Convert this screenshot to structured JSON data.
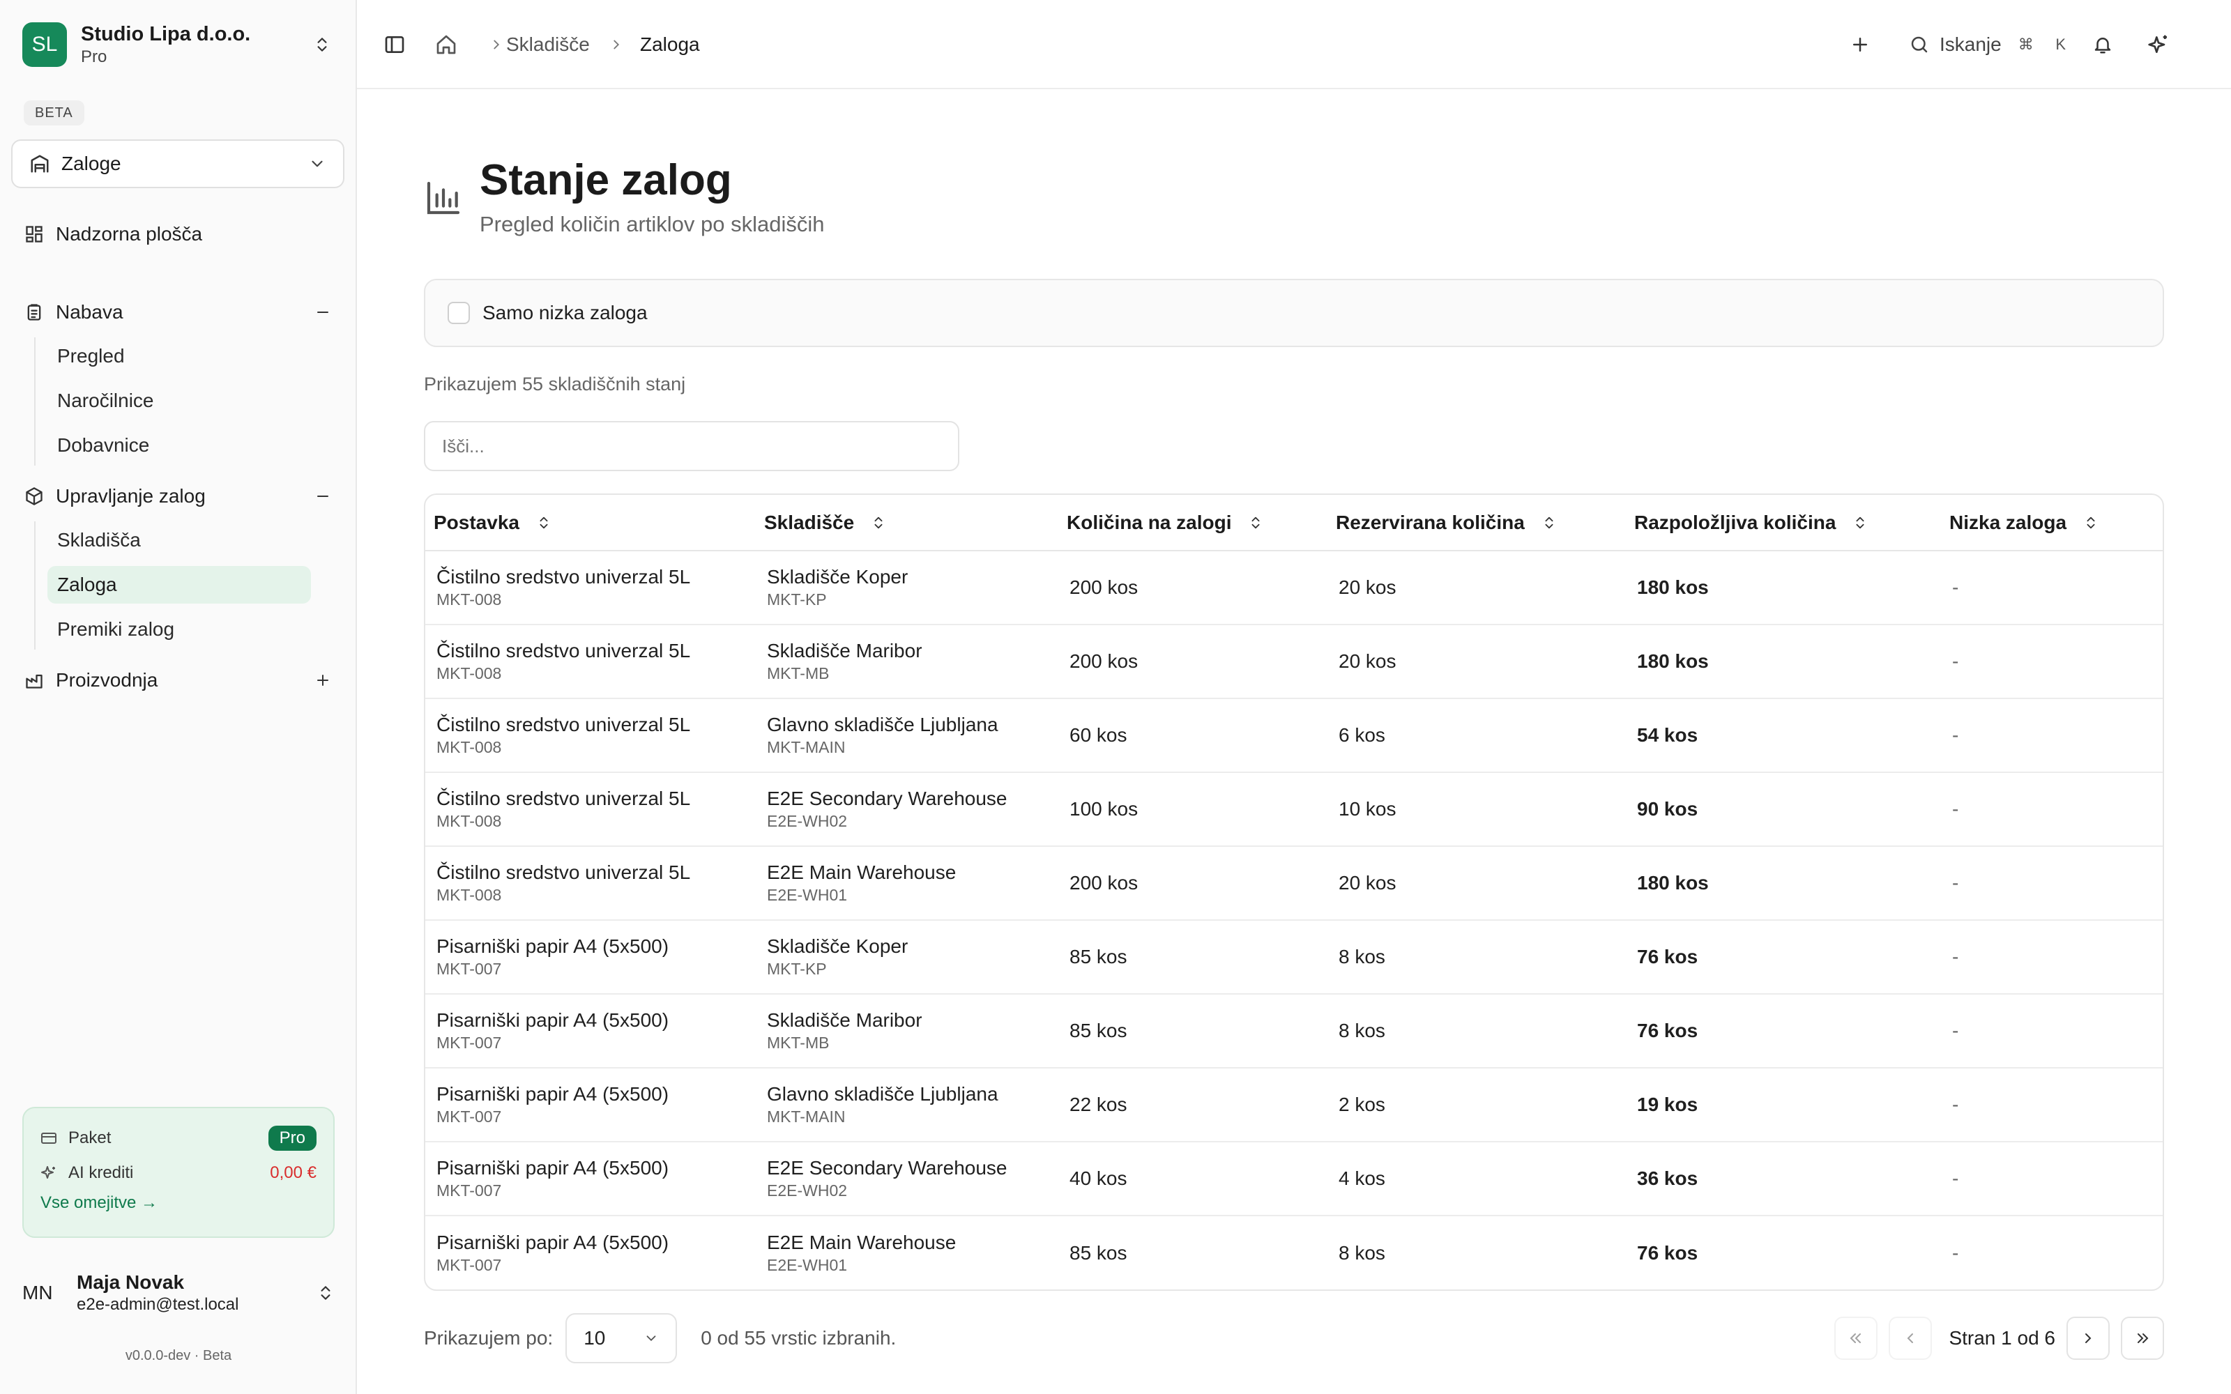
{
  "org": {
    "initials": "SL",
    "name": "Studio Lipa d.o.o.",
    "plan": "Pro"
  },
  "beta_label": "BETA",
  "module": {
    "selected": "Zaloge"
  },
  "nav": {
    "dashboard": "Nadzorna plošča",
    "nabava": {
      "label": "Nabava",
      "items": [
        "Pregled",
        "Naročilnice",
        "Dobavnice"
      ]
    },
    "upravljanje": {
      "label": "Upravljanje zalog",
      "items": [
        "Skladišča",
        "Zaloga",
        "Premiki zalog"
      ]
    },
    "proizvodnja": {
      "label": "Proizvodnja"
    }
  },
  "plan_card": {
    "paket_label": "Paket",
    "paket_value": "Pro",
    "credits_label": "AI krediti",
    "credits_value": "0,00 €",
    "limits_link": "Vse omejitve →"
  },
  "user": {
    "initials": "MN",
    "name": "Maja Novak",
    "email": "e2e-admin@test.local"
  },
  "version": "v0.0.0-dev · Beta",
  "breadcrumb": {
    "warehouse": "Skladišče",
    "current": "Zaloga"
  },
  "topbar": {
    "search_label": "Iskanje",
    "kbd_cmd": "⌘",
    "kbd_key": "K"
  },
  "page": {
    "title": "Stanje zalog",
    "subtitle": "Pregled količin artiklov po skladiščih"
  },
  "filter": {
    "low_stock_label": "Samo nizka zaloga"
  },
  "count_text": "Prikazujem 55 skladiščnih stanj",
  "search": {
    "placeholder": "Išči..."
  },
  "table": {
    "columns": [
      "Postavka",
      "Skladišče",
      "Količina na zalogi",
      "Rezervirana količina",
      "Razpoložljiva količina",
      "Nizka zaloga"
    ],
    "rows": [
      {
        "item": "Čistilno sredstvo univerzal 5L",
        "sku": "MKT-008",
        "warehouse": "Skladišče Koper",
        "code": "MKT-KP",
        "qty": "200 kos",
        "reserved": "20 kos",
        "available": "180 kos",
        "low": "-"
      },
      {
        "item": "Čistilno sredstvo univerzal 5L",
        "sku": "MKT-008",
        "warehouse": "Skladišče Maribor",
        "code": "MKT-MB",
        "qty": "200 kos",
        "reserved": "20 kos",
        "available": "180 kos",
        "low": "-"
      },
      {
        "item": "Čistilno sredstvo univerzal 5L",
        "sku": "MKT-008",
        "warehouse": "Glavno skladišče Ljubljana",
        "code": "MKT-MAIN",
        "qty": "60 kos",
        "reserved": "6 kos",
        "available": "54 kos",
        "low": "-"
      },
      {
        "item": "Čistilno sredstvo univerzal 5L",
        "sku": "MKT-008",
        "warehouse": "E2E Secondary Warehouse",
        "code": "E2E-WH02",
        "qty": "100 kos",
        "reserved": "10 kos",
        "available": "90 kos",
        "low": "-"
      },
      {
        "item": "Čistilno sredstvo univerzal 5L",
        "sku": "MKT-008",
        "warehouse": "E2E Main Warehouse",
        "code": "E2E-WH01",
        "qty": "200 kos",
        "reserved": "20 kos",
        "available": "180 kos",
        "low": "-"
      },
      {
        "item": "Pisarniški papir A4 (5x500)",
        "sku": "MKT-007",
        "warehouse": "Skladišče Koper",
        "code": "MKT-KP",
        "qty": "85 kos",
        "reserved": "8 kos",
        "available": "76 kos",
        "low": "-"
      },
      {
        "item": "Pisarniški papir A4 (5x500)",
        "sku": "MKT-007",
        "warehouse": "Skladišče Maribor",
        "code": "MKT-MB",
        "qty": "85 kos",
        "reserved": "8 kos",
        "available": "76 kos",
        "low": "-"
      },
      {
        "item": "Pisarniški papir A4 (5x500)",
        "sku": "MKT-007",
        "warehouse": "Glavno skladišče Ljubljana",
        "code": "MKT-MAIN",
        "qty": "22 kos",
        "reserved": "2 kos",
        "available": "19 kos",
        "low": "-"
      },
      {
        "item": "Pisarniški papir A4 (5x500)",
        "sku": "MKT-007",
        "warehouse": "E2E Secondary Warehouse",
        "code": "E2E-WH02",
        "qty": "40 kos",
        "reserved": "4 kos",
        "available": "36 kos",
        "low": "-"
      },
      {
        "item": "Pisarniški papir A4 (5x500)",
        "sku": "MKT-007",
        "warehouse": "E2E Main Warehouse",
        "code": "E2E-WH01",
        "qty": "85 kos",
        "reserved": "8 kos",
        "available": "76 kos",
        "low": "-"
      }
    ]
  },
  "pager": {
    "per_page_label": "Prikazujem po:",
    "per_page_value": "10",
    "selected_info": "0 od 55 vrstic izbranih.",
    "page_info": "Stran 1 od 6"
  },
  "colors": {
    "brand": "#16895a",
    "active_bg": "#e4f3ea",
    "danger": "#d92d2d"
  }
}
